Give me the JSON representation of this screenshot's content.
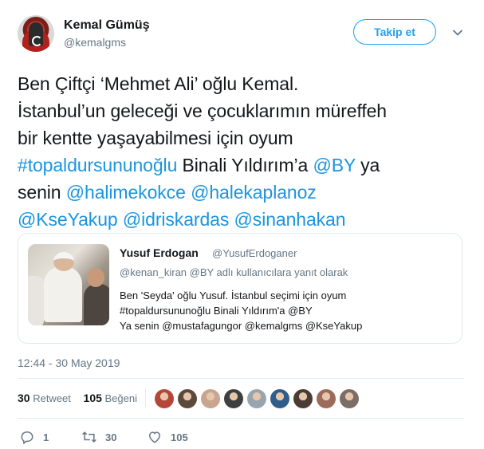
{
  "author": {
    "name": "Kemal Gümüş",
    "handle": "@kemalgms",
    "follow_label": "Takip et"
  },
  "tweet": {
    "lines": [
      [
        {
          "t": "Ben Çiftçi ‘Mehmet Ali’ oğlu Kemal.",
          "link": false
        }
      ],
      [
        {
          "t": "İstanbul’un geleceği ve çocuklarımın müreffeh",
          "link": false
        }
      ],
      [
        {
          "t": "bir kentte yaşayabilmesi için oyum",
          "link": false
        }
      ],
      [
        {
          "t": "#topaldursununoğlu",
          "link": true
        },
        {
          "t": " Binali Yıldırım’a ",
          "link": false
        },
        {
          "t": "@BY",
          "link": true
        },
        {
          "t": " ya",
          "link": false
        }
      ],
      [
        {
          "t": "senin ",
          "link": false
        },
        {
          "t": "@halimekokce",
          "link": true
        },
        {
          "t": " ",
          "link": false
        },
        {
          "t": "@halekaplanoz",
          "link": true
        }
      ],
      [
        {
          "t": "@KseYakup",
          "link": true
        },
        {
          "t": " ",
          "link": false
        },
        {
          "t": "@idriskardas",
          "link": true
        },
        {
          "t": " ",
          "link": false
        },
        {
          "t": "@sinanhakan",
          "link": true
        }
      ]
    ]
  },
  "quoted": {
    "name": "Yusuf Erdogan",
    "handle": "@YusufErdoganer",
    "reply_line": "@kenan_kiran @BY adlı kullanıcılara yanıt olarak",
    "text_lines": [
      "Ben 'Seyda' oğlu Yusuf. İstanbul seçimi için oyum",
      "#topaldursununoğlu Binali Yıldırım'a @BY",
      "Ya senin @mustafagungor @kemalgms @KseYakup"
    ]
  },
  "timestamp": "12:44 - 30 May 2019",
  "stats": {
    "retweets_count": "30",
    "retweets_label": "Retweet",
    "likes_count": "105",
    "likes_label": "Beğeni"
  },
  "likers": [
    {
      "color": "#b5473a"
    },
    {
      "color": "#5b4a3c"
    },
    {
      "color": "#c9a48f"
    },
    {
      "color": "#3f3f3f"
    },
    {
      "color": "#9aa4ad"
    },
    {
      "color": "#2f5d8c"
    },
    {
      "color": "#4a3b33"
    },
    {
      "color": "#9d6b5a"
    },
    {
      "color": "#7b6e66"
    }
  ],
  "actions": {
    "reply_count": "1",
    "retweet_count": "30",
    "like_count": "105"
  },
  "colors": {
    "accent": "#1da1f2",
    "link": "#1b95e0",
    "muted": "#657786"
  },
  "icons": [
    "chevron-down-icon",
    "reply-icon",
    "retweet-icon",
    "like-icon"
  ]
}
